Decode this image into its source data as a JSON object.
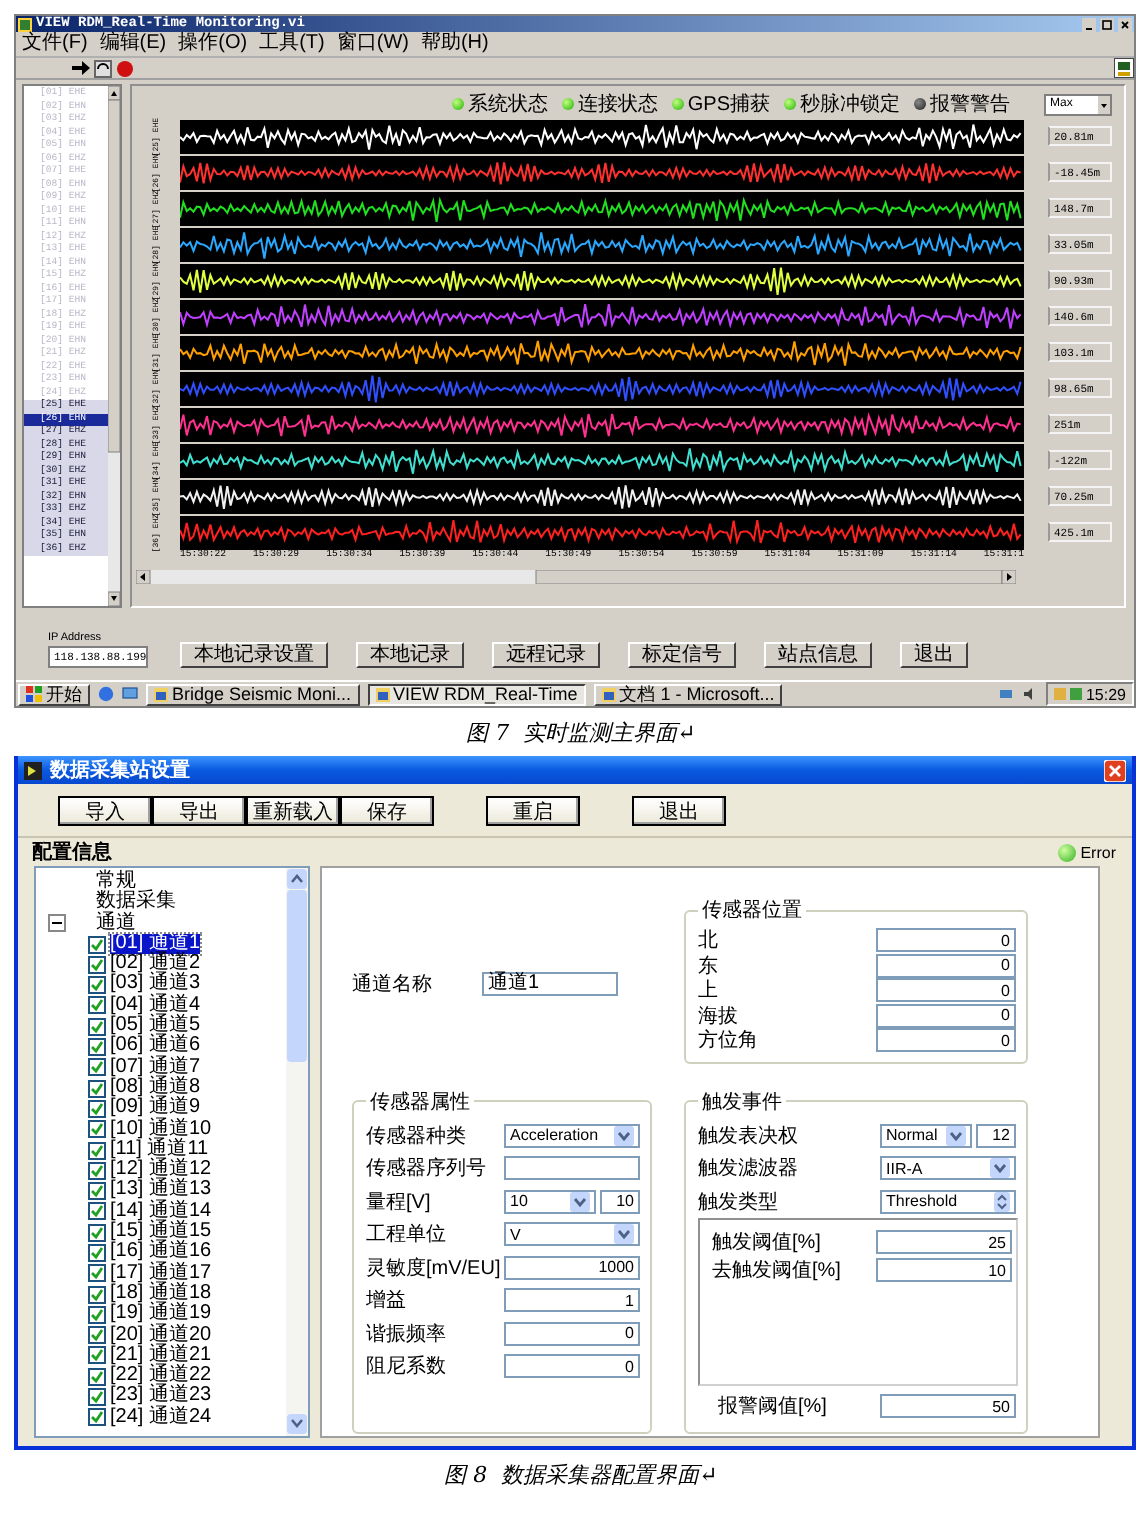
{
  "monitor": {
    "title": "VIEW RDM_Real-Time Monitoring.vi",
    "menu": [
      "文件(F)",
      "编辑(E)",
      "操作(O)",
      "工具(T)",
      "窗口(W)",
      "帮助(H)"
    ],
    "channels": [
      {
        "label": "[01] EHE",
        "active": false,
        "selected": false
      },
      {
        "label": "[02] EHN",
        "active": false,
        "selected": false
      },
      {
        "label": "[03] EHZ",
        "active": false,
        "selected": false
      },
      {
        "label": "[04] EHE",
        "active": false,
        "selected": false
      },
      {
        "label": "[05] EHN",
        "active": false,
        "selected": false
      },
      {
        "label": "[06] EHZ",
        "active": false,
        "selected": false
      },
      {
        "label": "[07] EHE",
        "active": false,
        "selected": false
      },
      {
        "label": "[08] EHN",
        "active": false,
        "selected": false
      },
      {
        "label": "[09] EHZ",
        "active": false,
        "selected": false
      },
      {
        "label": "[10] EHE",
        "active": false,
        "selected": false
      },
      {
        "label": "[11] EHN",
        "active": false,
        "selected": false
      },
      {
        "label": "[12] EHZ",
        "active": false,
        "selected": false
      },
      {
        "label": "[13] EHE",
        "active": false,
        "selected": false
      },
      {
        "label": "[14] EHN",
        "active": false,
        "selected": false
      },
      {
        "label": "[15] EHZ",
        "active": false,
        "selected": false
      },
      {
        "label": "[16] EHE",
        "active": false,
        "selected": false
      },
      {
        "label": "[17] EHN",
        "active": false,
        "selected": false
      },
      {
        "label": "[18] EHZ",
        "active": false,
        "selected": false
      },
      {
        "label": "[19] EHE",
        "active": false,
        "selected": false
      },
      {
        "label": "[20] EHN",
        "active": false,
        "selected": false
      },
      {
        "label": "[21] EHZ",
        "active": false,
        "selected": false
      },
      {
        "label": "[22] EHE",
        "active": false,
        "selected": false
      },
      {
        "label": "[23] EHN",
        "active": false,
        "selected": false
      },
      {
        "label": "[24] EHZ",
        "active": false,
        "selected": false
      },
      {
        "label": "[25] EHE",
        "active": true,
        "selected": false
      },
      {
        "label": "[26] EHN",
        "active": true,
        "selected": true
      },
      {
        "label": "[27] EHZ",
        "active": true,
        "selected": false
      },
      {
        "label": "[28] EHE",
        "active": true,
        "selected": false
      },
      {
        "label": "[29] EHN",
        "active": true,
        "selected": false
      },
      {
        "label": "[30] EHZ",
        "active": true,
        "selected": false
      },
      {
        "label": "[31] EHE",
        "active": true,
        "selected": false
      },
      {
        "label": "[32] EHN",
        "active": true,
        "selected": false
      },
      {
        "label": "[33] EHZ",
        "active": true,
        "selected": false
      },
      {
        "label": "[34] EHE",
        "active": true,
        "selected": false
      },
      {
        "label": "[35] EHN",
        "active": true,
        "selected": false
      },
      {
        "label": "[36] EHZ",
        "active": true,
        "selected": false
      }
    ],
    "indicators": [
      {
        "label": "系统状态",
        "on": true
      },
      {
        "label": "连接状态",
        "on": true
      },
      {
        "label": "GPS捕获",
        "on": true
      },
      {
        "label": "秒脉冲锁定",
        "on": true
      },
      {
        "label": "报警警告",
        "on": false
      }
    ],
    "mode_select": {
      "value": "Max"
    },
    "traces": [
      {
        "label": "[25] EHE",
        "color": "#ffffff",
        "reading": "20.81m"
      },
      {
        "label": "[26] EHN",
        "color": "#ff3030",
        "reading": "-18.45m"
      },
      {
        "label": "[27] EHZ",
        "color": "#20e020",
        "reading": "148.7m"
      },
      {
        "label": "[28] EHE",
        "color": "#2aa8ff",
        "reading": "33.05m"
      },
      {
        "label": "[29] EHN",
        "color": "#e0ff40",
        "reading": "90.93m"
      },
      {
        "label": "[30] EHZ",
        "color": "#c040ff",
        "reading": "140.6m"
      },
      {
        "label": "[31] EHE",
        "color": "#ffa000",
        "reading": "103.1m"
      },
      {
        "label": "[32] EHN",
        "color": "#3050ff",
        "reading": "98.65m"
      },
      {
        "label": "[33] EHZ",
        "color": "#ff3090",
        "reading": "251m"
      },
      {
        "label": "[34] EHE",
        "color": "#40e0d0",
        "reading": "-122m"
      },
      {
        "label": "[35] EHN",
        "color": "#f0f0f0",
        "reading": "70.25m"
      },
      {
        "label": "[36] EHZ",
        "color": "#ff2020",
        "reading": "425.1m"
      }
    ],
    "time_ticks": [
      "15:30:22",
      "15:30:29",
      "15:30:34",
      "15:30:39",
      "15:30:44",
      "15:30:49",
      "15:30:54",
      "15:30:59",
      "15:31:04",
      "15:31:09",
      "15:31:14",
      "15:31:1"
    ],
    "ip_address": {
      "label": "IP Address",
      "value": "118.138.88.199"
    },
    "buttons": [
      "本地记录设置",
      "本地记录",
      "远程记录",
      "标定信号",
      "站点信息",
      "退出"
    ],
    "taskbar": {
      "start": "开始",
      "tasks": [
        {
          "label": "Bridge Seismic Moni...",
          "selected": false
        },
        {
          "label": "VIEW RDM_Real-Time",
          "selected": true
        },
        {
          "label": "文档 1 - Microsoft...",
          "selected": false
        }
      ],
      "clock": "15:29"
    }
  },
  "caption_1": "图 7  实时监测主界面↵",
  "config": {
    "title": "数据采集站设置",
    "toolbar_groups": [
      [
        "导入",
        "导出",
        "重新载入",
        "保存"
      ],
      [
        "重启"
      ],
      [
        "退出"
      ]
    ],
    "section_label": "配置信息",
    "status": {
      "label": "Error",
      "on": true
    },
    "tree": [
      {
        "label": "常规"
      },
      {
        "label": "数据采集"
      },
      {
        "label": "通道",
        "expanded": true,
        "children": [
          {
            "label": "[01] 通道1",
            "checked": true,
            "selected": true
          },
          {
            "label": "[02] 通道2",
            "checked": true,
            "selected": false
          },
          {
            "label": "[03] 通道3",
            "checked": true,
            "selected": false
          },
          {
            "label": "[04] 通道4",
            "checked": true,
            "selected": false
          },
          {
            "label": "[05] 通道5",
            "checked": true,
            "selected": false
          },
          {
            "label": "[06] 通道6",
            "checked": true,
            "selected": false
          },
          {
            "label": "[07] 通道7",
            "checked": true,
            "selected": false
          },
          {
            "label": "[08] 通道8",
            "checked": true,
            "selected": false
          },
          {
            "label": "[09] 通道9",
            "checked": true,
            "selected": false
          },
          {
            "label": "[10] 通道10",
            "checked": true,
            "selected": false
          },
          {
            "label": "[11] 通道11",
            "checked": true,
            "selected": false
          },
          {
            "label": "[12] 通道12",
            "checked": true,
            "selected": false
          },
          {
            "label": "[13] 通道13",
            "checked": true,
            "selected": false
          },
          {
            "label": "[14] 通道14",
            "checked": true,
            "selected": false
          },
          {
            "label": "[15] 通道15",
            "checked": true,
            "selected": false
          },
          {
            "label": "[16] 通道16",
            "checked": true,
            "selected": false
          },
          {
            "label": "[17] 通道17",
            "checked": true,
            "selected": false
          },
          {
            "label": "[18] 通道18",
            "checked": true,
            "selected": false
          },
          {
            "label": "[19] 通道19",
            "checked": true,
            "selected": false
          },
          {
            "label": "[20] 通道20",
            "checked": true,
            "selected": false
          },
          {
            "label": "[21] 通道21",
            "checked": true,
            "selected": false
          },
          {
            "label": "[22] 通道22",
            "checked": true,
            "selected": false
          },
          {
            "label": "[23] 通道23",
            "checked": true,
            "selected": false
          },
          {
            "label": "[24] 通道24",
            "checked": true,
            "selected": false
          }
        ]
      }
    ],
    "channel_name": {
      "label": "通道名称",
      "value": "通道1"
    },
    "position": {
      "title": "传感器位置",
      "fields": [
        {
          "label": "北",
          "value": "0"
        },
        {
          "label": "东",
          "value": "0"
        },
        {
          "label": "上",
          "value": "0"
        },
        {
          "label": "海拔",
          "value": "0"
        },
        {
          "label": "方位角",
          "value": "0"
        }
      ]
    },
    "sensor": {
      "title": "传感器属性",
      "fields": [
        {
          "label": "传感器种类",
          "kind": "dropdown",
          "value": "Acceleration"
        },
        {
          "label": "传感器序列号",
          "kind": "text"
        },
        {
          "label": "量程[V]",
          "kind": "pair",
          "value": "10",
          "extra": "10"
        },
        {
          "label": "工程单位",
          "kind": "dropdown",
          "value": "V"
        },
        {
          "label": "灵敏度[mV/EU]",
          "kind": "number",
          "value": "1000"
        },
        {
          "label": "增益",
          "kind": "number",
          "value": "1"
        },
        {
          "label": "谐振频率",
          "kind": "number",
          "value": "0"
        },
        {
          "label": "阻尼系数",
          "kind": "number",
          "value": "0"
        }
      ]
    },
    "trigger": {
      "title": "触发事件",
      "fields": [
        {
          "label": "触发表决权",
          "kind": "pair",
          "value": "Normal",
          "extra": "12"
        },
        {
          "label": "触发滤波器",
          "kind": "dropdown",
          "value": "IIR-A"
        },
        {
          "label": "触发类型",
          "kind": "spinner",
          "value": "Threshold"
        }
      ],
      "thresholds": [
        {
          "label": "触发阈值[%]",
          "value": "25"
        },
        {
          "label": "去触发阈值[%]",
          "value": "10"
        }
      ],
      "alarm": {
        "label": "报警阈值[%]",
        "value": "50"
      }
    }
  },
  "caption_2": "图 8  数据采集器配置界面↵"
}
